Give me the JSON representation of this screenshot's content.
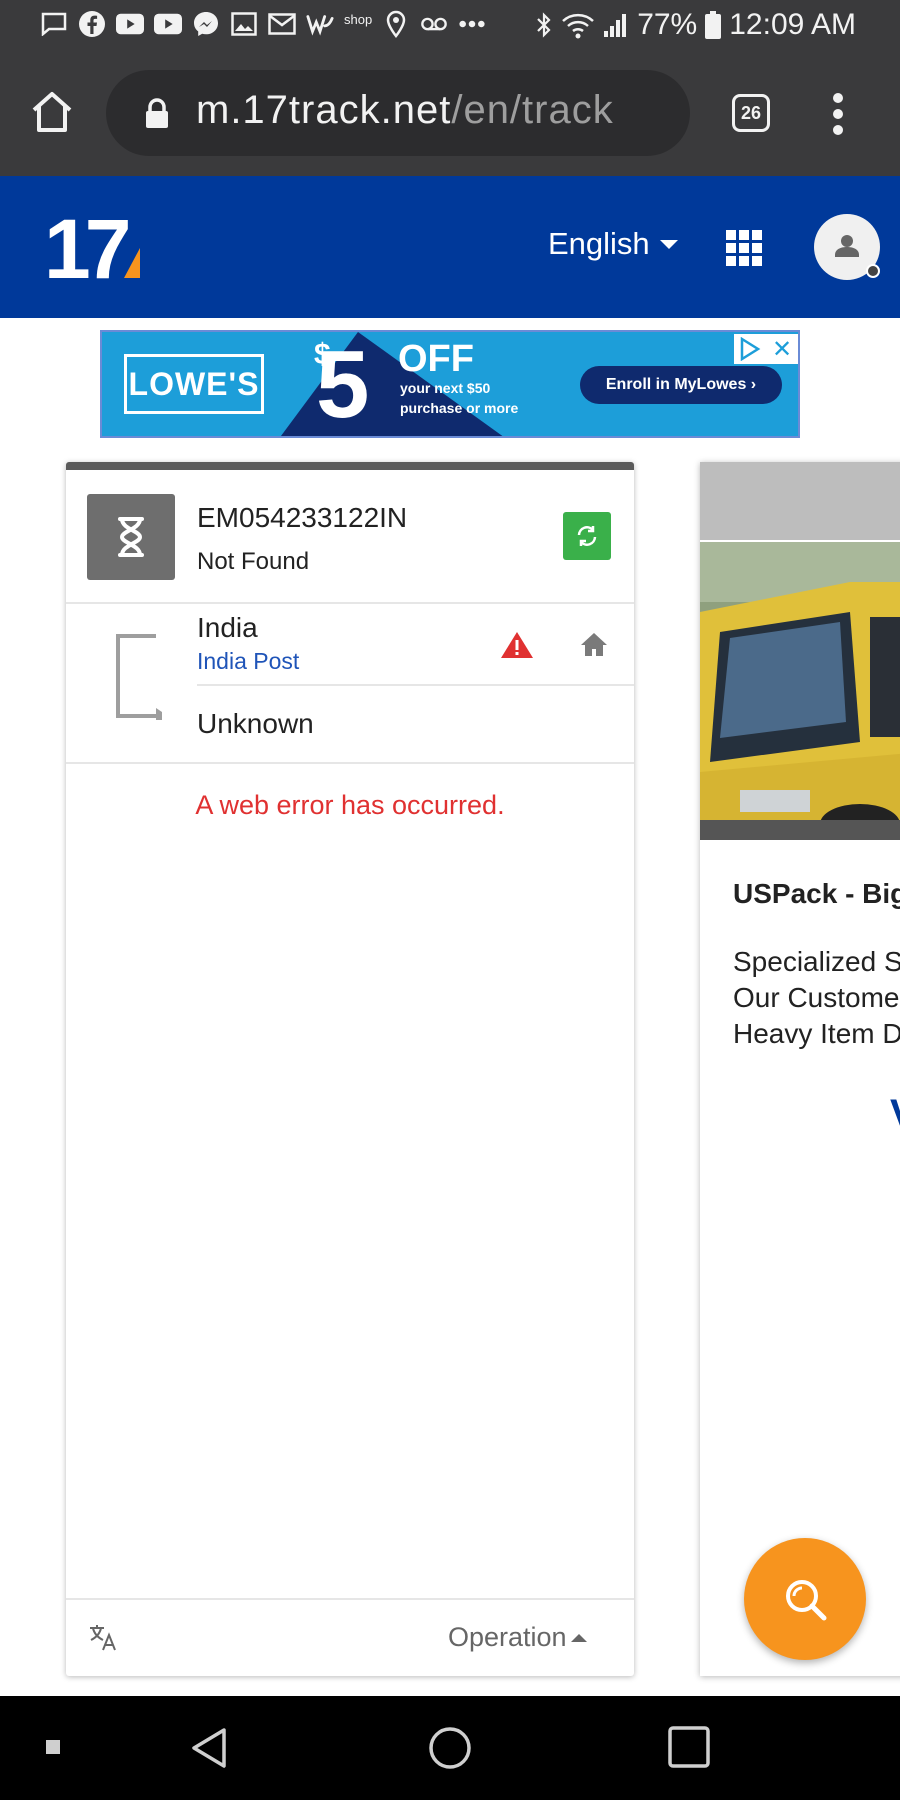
{
  "status_bar": {
    "shop_label": "shop",
    "battery": "77%",
    "time": "12:09 AM"
  },
  "browser": {
    "url_domain": "m.17track.net",
    "url_path": "/en/track",
    "tab_count": "26"
  },
  "header": {
    "logo": "17",
    "language": "English"
  },
  "ad": {
    "brand": "LOWE'S",
    "dollar": "$",
    "amount": "5",
    "off": "OFF",
    "subtext": "your next $50 purchase or more",
    "cta": "Enroll in MyLowes ›"
  },
  "track": {
    "number": "EM054233122IN",
    "status": "Not Found",
    "origin_country": "India",
    "carrier": "India Post",
    "destination": "Unknown",
    "error": "A web error has occurred.",
    "operation_label": "Operation"
  },
  "promo": {
    "title": "USPack - Big",
    "lines": [
      "Specialized S",
      "Our Custome",
      "Heavy Item D"
    ],
    "partial_letter": "V"
  },
  "colors": {
    "header_blue": "#00399a",
    "refresh_green": "#3ab04a",
    "error_red": "#e03131",
    "fab_orange": "#f7941e",
    "carrier_blue": "#1f54b8"
  }
}
